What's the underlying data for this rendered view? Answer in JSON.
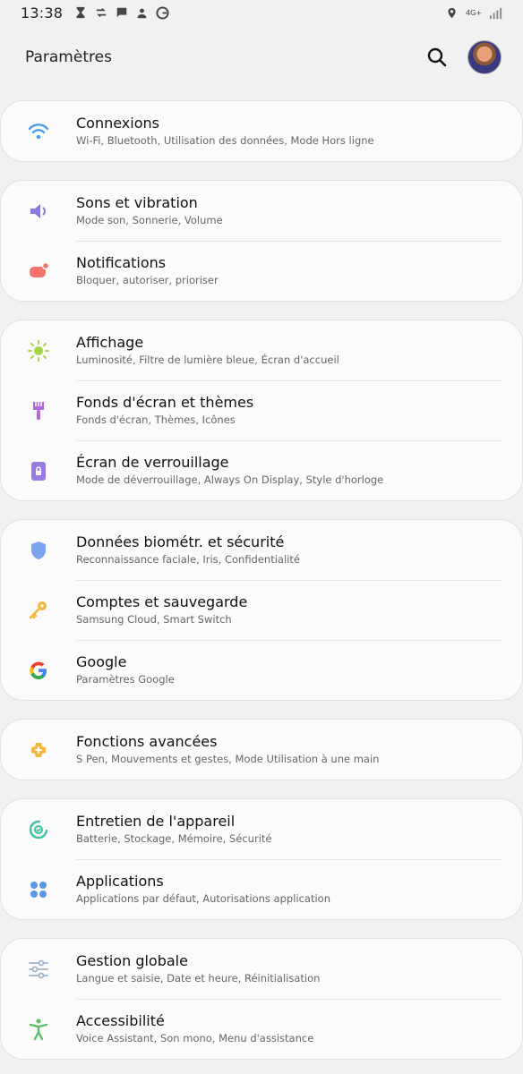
{
  "status_bar": {
    "time": "13:38",
    "network": "4G+"
  },
  "header": {
    "title": "Paramètres"
  },
  "groups": [
    {
      "items": [
        {
          "title": "Connexions",
          "subtitle": "Wi-Fi, Bluetooth, Utilisation des données, Mode Hors ligne",
          "icon": "wifi-icon",
          "color": "#4a9be8"
        }
      ]
    },
    {
      "items": [
        {
          "title": "Sons et vibration",
          "subtitle": "Mode son, Sonnerie, Volume",
          "icon": "volume-icon",
          "color": "#8b7be0"
        },
        {
          "title": "Notifications",
          "subtitle": "Bloquer, autoriser, prioriser",
          "icon": "notification-icon",
          "color": "#f07468"
        }
      ]
    },
    {
      "items": [
        {
          "title": "Affichage",
          "subtitle": "Luminosité, Filtre de lumière bleue, Écran d'accueil",
          "icon": "brightness-icon",
          "color": "#a6d44a"
        },
        {
          "title": "Fonds d'écran et thèmes",
          "subtitle": "Fonds d'écran, Thèmes, Icônes",
          "icon": "paintbrush-icon",
          "color": "#b36ad8"
        },
        {
          "title": "Écran de verrouillage",
          "subtitle": "Mode de déverrouillage, Always On Display, Style d'horloge",
          "icon": "lock-icon",
          "color": "#9a7be6"
        }
      ]
    },
    {
      "items": [
        {
          "title": "Données biométr. et sécurité",
          "subtitle": "Reconnaissance faciale, Iris, Confidentialité",
          "icon": "shield-icon",
          "color": "#7aa3f0"
        },
        {
          "title": "Comptes et sauvegarde",
          "subtitle": "Samsung Cloud, Smart Switch",
          "icon": "key-icon",
          "color": "#f3b63a"
        },
        {
          "title": "Google",
          "subtitle": "Paramètres Google",
          "icon": "google-icon",
          "color": "#4285f4"
        }
      ]
    },
    {
      "items": [
        {
          "title": "Fonctions avancées",
          "subtitle": "S Pen, Mouvements et gestes, Mode Utilisation à une main",
          "icon": "gear-plus-icon",
          "color": "#f5b73b"
        }
      ]
    },
    {
      "items": [
        {
          "title": "Entretien de l'appareil",
          "subtitle": "Batterie, Stockage, Mémoire, Sécurité",
          "icon": "device-care-icon",
          "color": "#3fc1a4"
        },
        {
          "title": "Applications",
          "subtitle": "Applications par défaut, Autorisations application",
          "icon": "apps-icon",
          "color": "#5a96e6"
        }
      ]
    },
    {
      "items": [
        {
          "title": "Gestion globale",
          "subtitle": "Langue et saisie, Date et heure, Réinitialisation",
          "icon": "sliders-icon",
          "color": "#9fb4c6"
        },
        {
          "title": "Accessibilité",
          "subtitle": "Voice Assistant, Son mono, Menu d'assistance",
          "icon": "accessibility-icon",
          "color": "#5cbf6a"
        }
      ]
    }
  ]
}
